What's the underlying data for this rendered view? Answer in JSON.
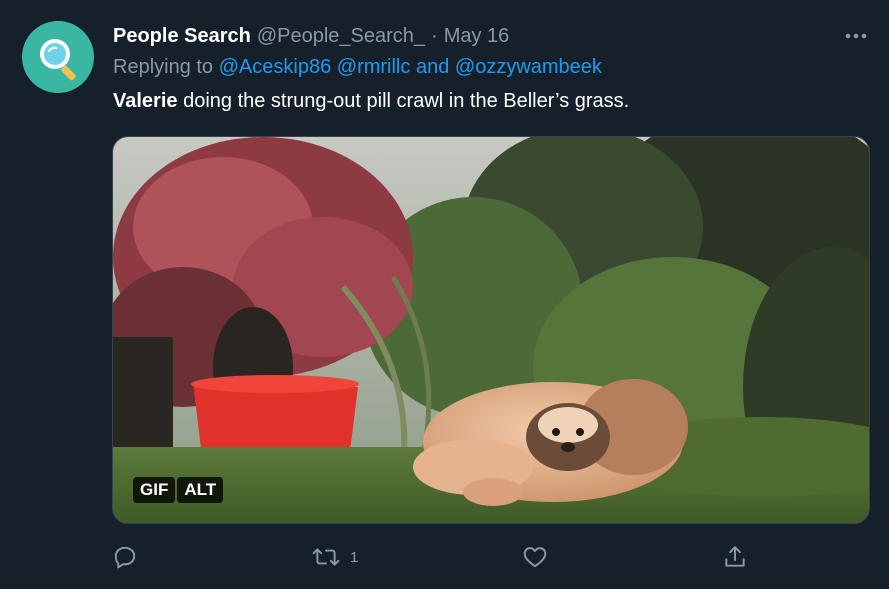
{
  "author": {
    "display_name": "People Search",
    "handle": "@People_Search_",
    "separator": "·",
    "date": "May 16"
  },
  "replying": {
    "prefix": "Replying to",
    "mention_1": "@Aceskip86",
    "mention_2": "@rmrillc",
    "conjunction": "and",
    "mention_3": "@ozzywambeek"
  },
  "tweet": {
    "bold_name": "Valerie",
    "text": " doing the strung-out pill crawl in the Beller’s grass."
  },
  "media": {
    "gif_badge": "GIF",
    "alt_badge": "ALT"
  },
  "actions": {
    "reply_icon": "reply-icon",
    "retweet_icon": "retweet-icon",
    "retweet_count": "1",
    "like_icon": "heart-icon",
    "share_icon": "share-icon"
  },
  "colors": {
    "background": "#15202b",
    "link": "#1d9bf0",
    "muted": "#8b98a5",
    "avatar": "#3ab7a2"
  }
}
